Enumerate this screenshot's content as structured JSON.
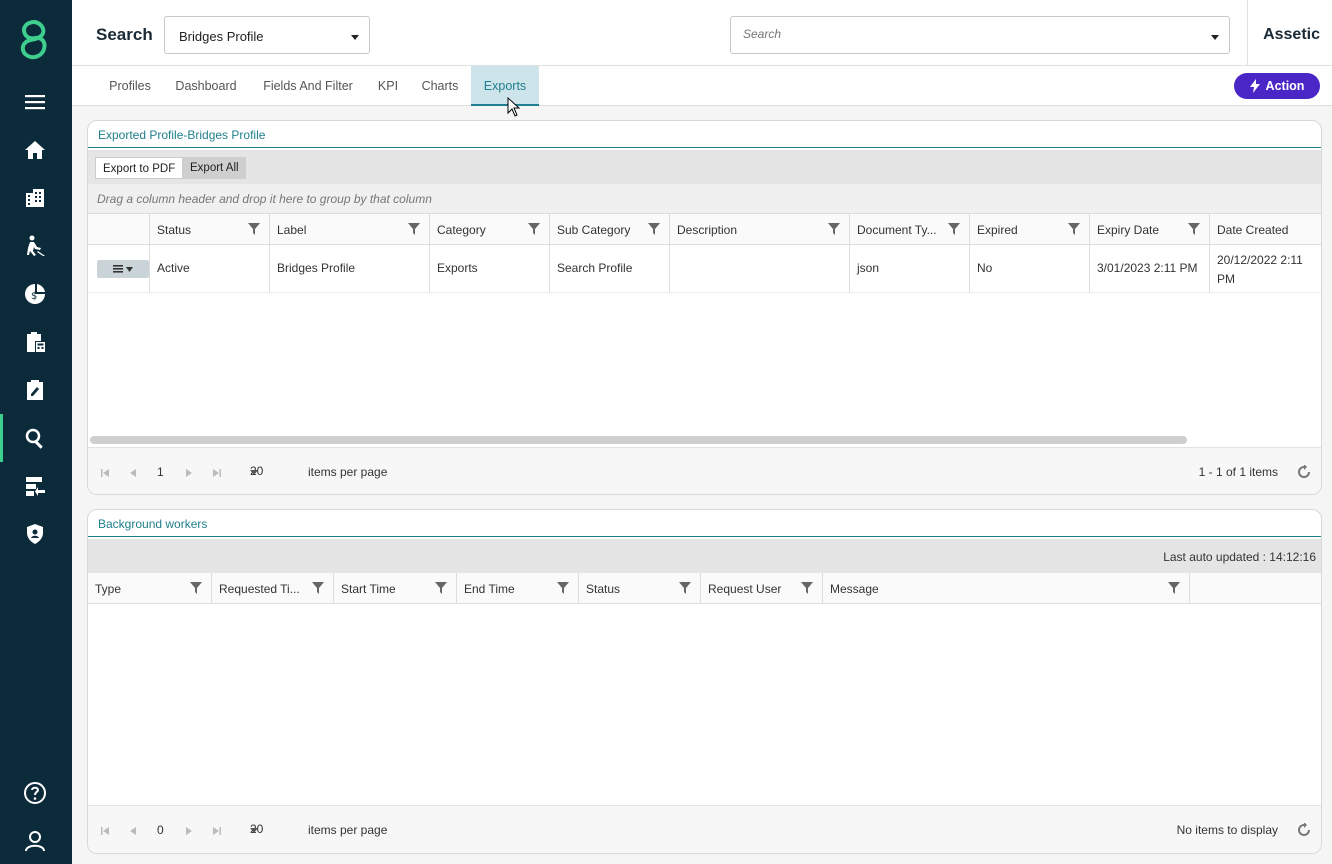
{
  "header": {
    "title": "Search",
    "profile_select": "Bridges Profile",
    "search_placeholder": "Search",
    "brand": "Assetic"
  },
  "sidebar": {
    "items": [
      {
        "icon": "menu-icon"
      },
      {
        "icon": "home-icon"
      },
      {
        "icon": "buildings-icon"
      },
      {
        "icon": "worker-icon"
      },
      {
        "icon": "finance-icon"
      },
      {
        "icon": "clipboard-calc-icon"
      },
      {
        "icon": "clipboard-edit-icon"
      },
      {
        "icon": "search-icon",
        "active": true
      },
      {
        "icon": "import-icon"
      },
      {
        "icon": "shield-user-icon"
      },
      {
        "icon": "help-icon"
      },
      {
        "icon": "user-icon"
      }
    ],
    "accent": "#3ecf8e"
  },
  "tabs": {
    "items": [
      "Profiles",
      "Dashboard",
      "Fields And Filter",
      "KPI",
      "Charts",
      "Exports"
    ],
    "active": "Exports",
    "action_label": "Action"
  },
  "exports_panel": {
    "title": "Exported Profile-Bridges Profile",
    "export_pdf": "Export to PDF",
    "export_all": "Export All",
    "group_hint": "Drag a column header and drop it here to group by that column",
    "columns": [
      "Status",
      "Label",
      "Category",
      "Sub Category",
      "Description",
      "Document Ty...",
      "Expired",
      "Expiry Date",
      "Date Created"
    ],
    "rows": [
      {
        "status": "Active",
        "label": "Bridges Profile",
        "category": "Exports",
        "sub_category": "Search Profile",
        "description": "",
        "document_type": "json",
        "expired": "No",
        "expiry_date": "3/01/2023 2:11 PM",
        "date_created": "20/12/2022 2:11 PM"
      }
    ],
    "pager": {
      "page": "1",
      "page_size": "20",
      "items_per_page": "items per page",
      "info": "1 - 1 of 1 items"
    }
  },
  "workers_panel": {
    "title": "Background workers",
    "last_updated": "Last auto updated : 14:12:16",
    "columns": [
      "Type",
      "Requested Ti...",
      "Start Time",
      "End Time",
      "Status",
      "Request User",
      "Message"
    ],
    "pager": {
      "page": "0",
      "page_size": "20",
      "items_per_page": "items per page",
      "info": "No items to display"
    }
  },
  "colors": {
    "sidebar_bg": "#0b2a3a",
    "teal": "#1f7f8c",
    "action": "#4b26c7"
  }
}
